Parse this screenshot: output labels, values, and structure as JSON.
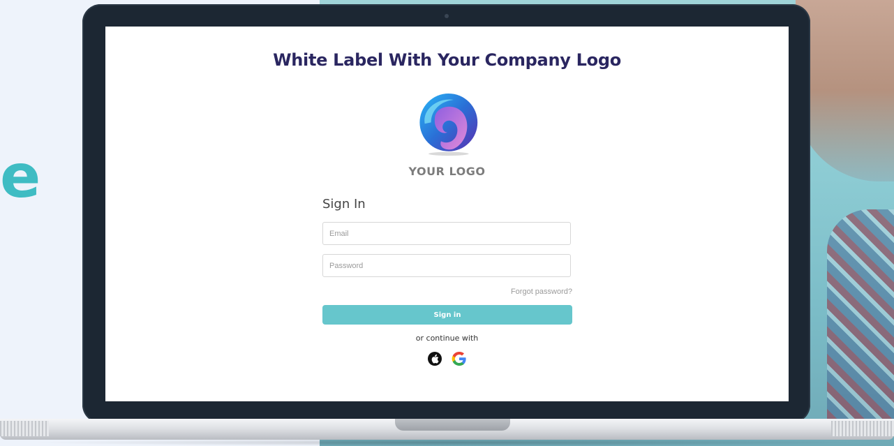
{
  "page": {
    "title": "White Label With Your Company Logo"
  },
  "logo": {
    "text": "YOUR LOGO",
    "icon": "swirl-logo-icon",
    "colors": [
      "#2a6fd6",
      "#7b3fc4",
      "#c67ad7",
      "#1fa3e0"
    ]
  },
  "signin": {
    "heading": "Sign In",
    "email_placeholder": "Email",
    "email_value": "",
    "password_placeholder": "Password",
    "password_value": "",
    "forgot_password": "Forgot password?",
    "submit_label": "Sign in",
    "continue_text": "or continue with",
    "social_icons": [
      "apple-icon",
      "google-icon"
    ]
  },
  "background": {
    "brand_letter": "e"
  },
  "colors": {
    "accent": "#66c6cc",
    "title": "#2a2660",
    "bezel": "#1c2733",
    "brand": "#3fbcc3"
  }
}
